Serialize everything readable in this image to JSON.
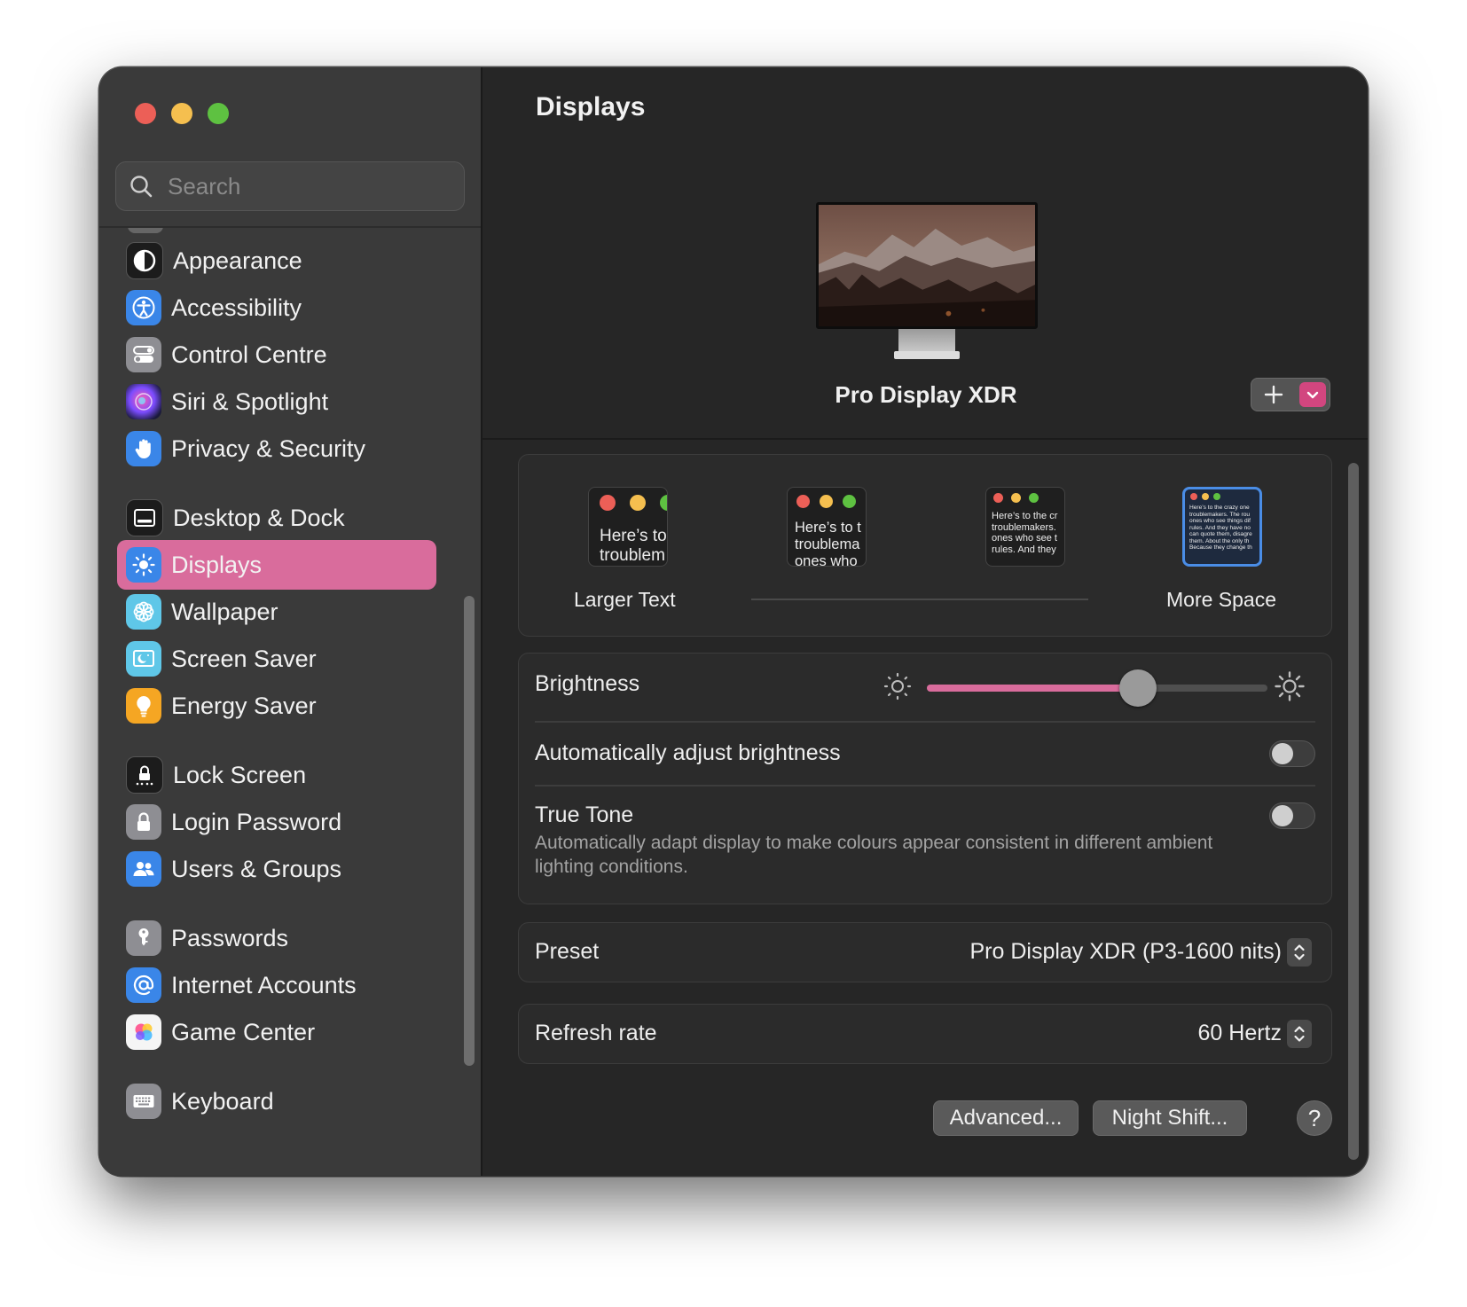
{
  "window": {
    "colors": {
      "accent": "#d96c9c",
      "selection_blue": "#4a8de6",
      "background": "#262626",
      "sidebar": "#3a3a3a"
    }
  },
  "sidebar": {
    "search_placeholder": "Search",
    "items": [
      {
        "label": "Appearance",
        "icon": "appearance-icon"
      },
      {
        "label": "Accessibility",
        "icon": "accessibility-icon"
      },
      {
        "label": "Control Centre",
        "icon": "control-centre-icon"
      },
      {
        "label": "Siri & Spotlight",
        "icon": "siri-icon"
      },
      {
        "label": "Privacy & Security",
        "icon": "hand-icon"
      },
      {
        "label": "Desktop & Dock",
        "icon": "desktop-dock-icon"
      },
      {
        "label": "Displays",
        "icon": "displays-sun-icon",
        "selected": true
      },
      {
        "label": "Wallpaper",
        "icon": "wallpaper-flower-icon"
      },
      {
        "label": "Screen Saver",
        "icon": "screen-saver-icon"
      },
      {
        "label": "Energy Saver",
        "icon": "lightbulb-icon"
      },
      {
        "label": "Lock Screen",
        "icon": "lock-screen-icon"
      },
      {
        "label": "Login Password",
        "icon": "padlock-icon"
      },
      {
        "label": "Users & Groups",
        "icon": "users-icon"
      },
      {
        "label": "Passwords",
        "icon": "key-icon"
      },
      {
        "label": "Internet Accounts",
        "icon": "at-sign-icon"
      },
      {
        "label": "Game Center",
        "icon": "game-center-icon"
      },
      {
        "label": "Keyboard",
        "icon": "keyboard-icon"
      }
    ]
  },
  "main": {
    "title": "Displays",
    "display_name": "Pro Display XDR",
    "resolution": {
      "left_label": "Larger Text",
      "right_label": "More Space",
      "thumbs": [
        {
          "text": "Here’s to\ntroublem"
        },
        {
          "text": "Here’s to t\ntroublema\nones who"
        },
        {
          "text": "Here’s to the cr\ntroublemakers.\nones who see t\nrules. And they"
        },
        {
          "text": "Here’s to the crazy one\ntroublemakers. The rou\nones who see things dif\nrules. And they have no\ncan quote them, disagre\nthem. About the only th\nBecause they change th",
          "selected": true
        }
      ]
    },
    "brightness": {
      "label": "Brightness",
      "value": 0.62,
      "auto_label": "Automatically adjust brightness",
      "auto_on": false,
      "true_tone_label": "True Tone",
      "true_tone_desc": "Automatically adapt display to make colours appear consistent in different ambient lighting conditions.",
      "true_tone_on": false
    },
    "preset": {
      "label": "Preset",
      "value": "Pro Display XDR (P3-1600 nits)"
    },
    "refresh": {
      "label": "Refresh rate",
      "value": "60 Hertz"
    },
    "buttons": {
      "advanced": "Advanced...",
      "night_shift": "Night Shift...",
      "help": "?"
    }
  }
}
